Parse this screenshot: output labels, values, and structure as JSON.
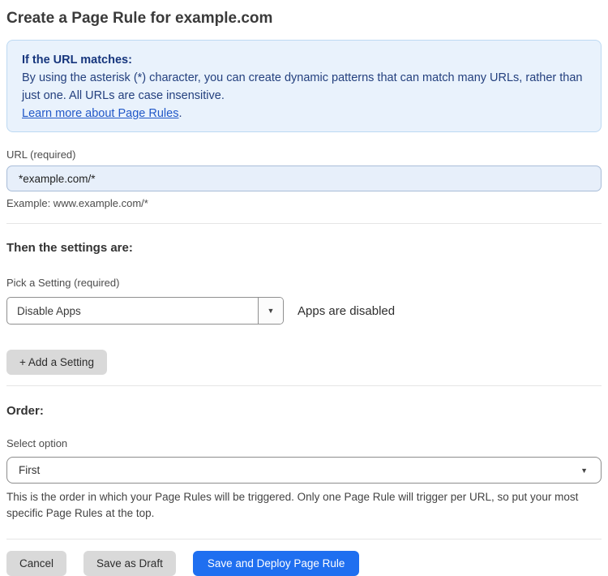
{
  "page": {
    "title": "Create a Page Rule for example.com"
  },
  "info_box": {
    "heading": "If the URL matches:",
    "body": "By using the asterisk (*) character, you can create dynamic patterns that can match many URLs, rather than just one. All URLs are case insensitive.",
    "link_label": "Learn more about Page Rules",
    "link_suffix": "."
  },
  "url_field": {
    "label": "URL (required)",
    "value": "*example.com/*",
    "helper": "Example: www.example.com/*"
  },
  "settings_section": {
    "heading": "Then the settings are:",
    "picker_label": "Pick a Setting (required)",
    "picker_value": "Disable Apps",
    "picker_status": "Apps are disabled",
    "dropdown_icon": "▼",
    "add_setting_label": "+ Add a Setting"
  },
  "order_section": {
    "heading": "Order:",
    "select_label": "Select option",
    "select_value": "First",
    "caret_icon": "▼",
    "helper": "This is the order in which your Page Rules will be triggered. Only one Page Rule will trigger per URL, so put your most specific Page Rules at the top."
  },
  "footer": {
    "cancel_label": "Cancel",
    "save_draft_label": "Save as Draft",
    "save_deploy_label": "Save and Deploy Page Rule"
  },
  "colors": {
    "accent_blue": "#1f6ff0",
    "info_background": "#e9f2fc",
    "info_border": "#bdd9f2",
    "info_text": "#24407e",
    "link_blue": "#2158c8",
    "input_background": "#e7effa",
    "input_border": "#a9bdd8",
    "button_gray": "#d9d9d9"
  }
}
